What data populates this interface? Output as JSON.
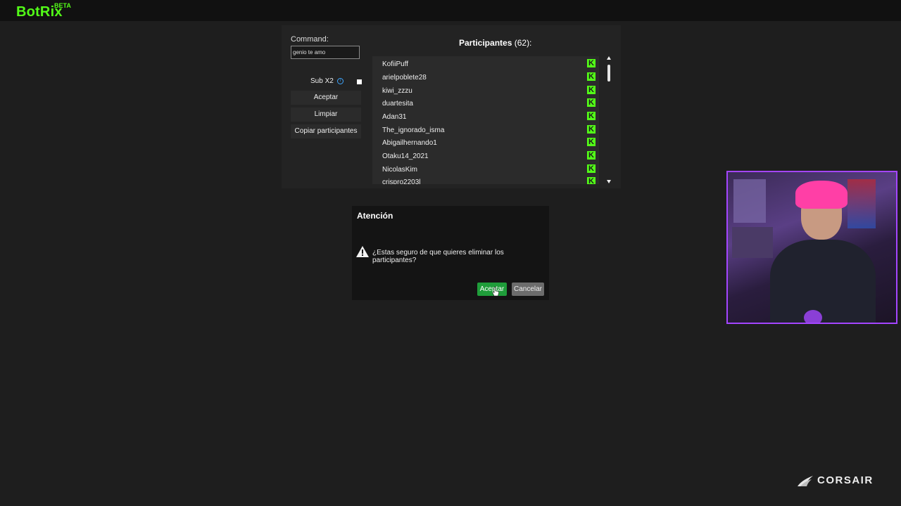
{
  "app": {
    "brand": "BotRix",
    "badge": "BETA"
  },
  "command": {
    "label": "Command:",
    "value": "genio te amo"
  },
  "sub_option": {
    "label": "Sub X2"
  },
  "buttons": {
    "accept": "Aceptar",
    "clear": "Limpiar",
    "copy": "Copiar participantes"
  },
  "participants": {
    "title": "Participantes",
    "count": "(62):",
    "items": [
      "KofiiPuff",
      "arielpoblete28",
      "kiwi_zzzu",
      "duartesita",
      "Adan31",
      "The_ignorado_isma",
      "Abigailhernando1",
      "Otaku14_2021",
      "NicolasKim",
      "crispro2203l"
    ],
    "platform_icon": "kick-icon",
    "accent": "#53fc18"
  },
  "dialog": {
    "title": "Atención",
    "message": "¿Estas seguro de que quieres eliminar los participantes?",
    "ok": "Aceptar",
    "cancel": "Cancelar",
    "ok_color": "#1f9d3a",
    "cancel_color": "#6c6c6c"
  },
  "overlay": {
    "sponsor": "CORSAIR",
    "webcam_border": "#a445ff"
  }
}
